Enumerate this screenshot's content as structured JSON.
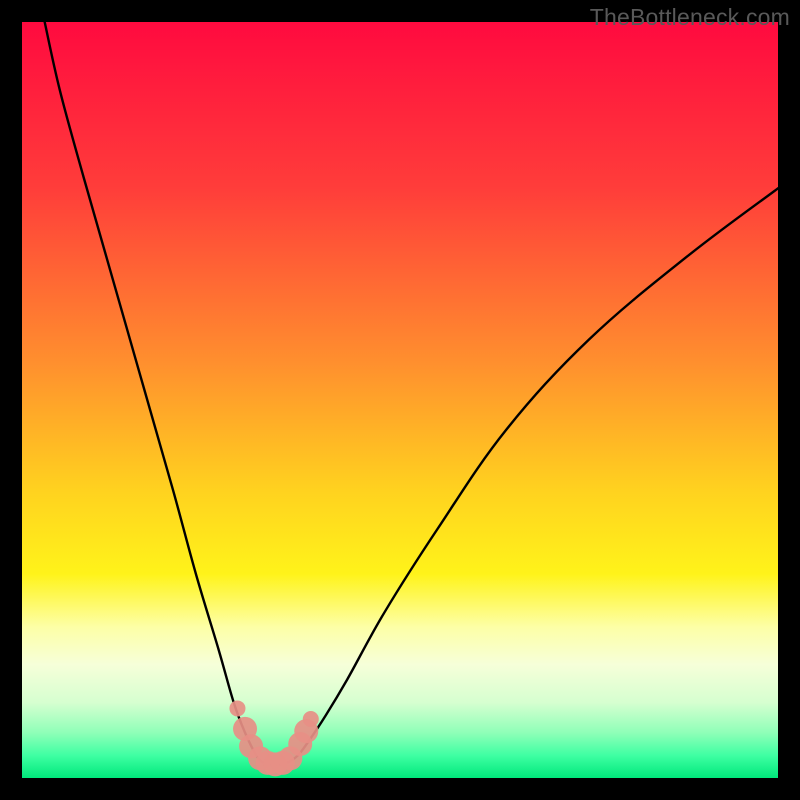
{
  "watermark": "TheBottleneck.com",
  "chart_data": {
    "type": "line",
    "title": "",
    "xlabel": "",
    "ylabel": "",
    "xlim": [
      0,
      100
    ],
    "ylim": [
      0,
      100
    ],
    "grid": false,
    "series": [
      {
        "name": "bottleneck-curve",
        "x": [
          3,
          5,
          8,
          12,
          16,
          20,
          23,
          26,
          28,
          29.5,
          31,
          32,
          33.5,
          35,
          36.5,
          38,
          40,
          43,
          48,
          55,
          64,
          75,
          88,
          100
        ],
        "y": [
          100,
          91,
          80,
          66,
          52,
          38,
          27,
          17,
          10,
          6,
          3,
          2,
          1.8,
          2,
          3,
          5,
          8,
          13,
          22,
          33,
          46,
          58,
          69,
          78
        ]
      },
      {
        "name": "bottleneck-markers",
        "x": [
          28.5,
          29.5,
          30.3,
          31.5,
          32.5,
          33.5,
          34.5,
          35.5,
          36.8,
          37.6,
          38.2
        ],
        "y": [
          9.2,
          6.5,
          4.2,
          2.6,
          2.0,
          1.8,
          2.0,
          2.6,
          4.5,
          6.2,
          7.8
        ]
      }
    ],
    "gradient_stops": [
      {
        "pos": 0,
        "color": "#ff0a3f"
      },
      {
        "pos": 22,
        "color": "#ff3d3a"
      },
      {
        "pos": 45,
        "color": "#ff8f2e"
      },
      {
        "pos": 62,
        "color": "#ffd21f"
      },
      {
        "pos": 73,
        "color": "#fff31a"
      },
      {
        "pos": 80,
        "color": "#fdffa6"
      },
      {
        "pos": 85,
        "color": "#f6ffd9"
      },
      {
        "pos": 90,
        "color": "#d6ffd0"
      },
      {
        "pos": 94,
        "color": "#8fffb8"
      },
      {
        "pos": 97,
        "color": "#3fffa3"
      },
      {
        "pos": 100,
        "color": "#00e87b"
      }
    ]
  }
}
